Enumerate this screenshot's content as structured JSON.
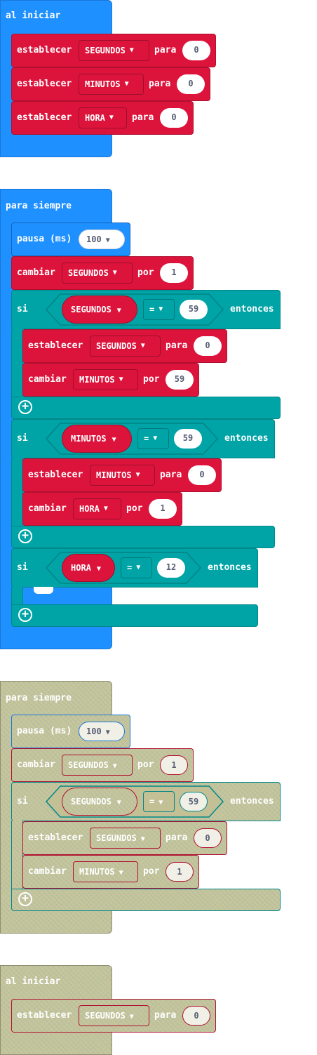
{
  "colors": {
    "events": "#1e90ff",
    "variables": "#dc143c",
    "logic": "#00a4a6",
    "disabled": "#c8c59c"
  },
  "group1": {
    "hat": "al iniciar",
    "rows": [
      {
        "verb": "establecer",
        "var": "SEGUNDOS",
        "prep": "para",
        "value": "0"
      },
      {
        "verb": "establecer",
        "var": "MINUTOS",
        "prep": "para",
        "value": "0"
      },
      {
        "verb": "establecer",
        "var": "HORA",
        "prep": "para",
        "value": "0"
      }
    ]
  },
  "group2": {
    "hat": "para siempre",
    "pause": {
      "label": "pausa (ms)",
      "value": "100"
    },
    "change": {
      "verb": "cambiar",
      "var": "SEGUNDOS",
      "prep": "por",
      "value": "1"
    },
    "if1": {
      "si": "si",
      "var": "SEGUNDOS",
      "op": "=",
      "value": "59",
      "then": "entonces",
      "set": {
        "verb": "establecer",
        "var": "SEGUNDOS",
        "prep": "para",
        "value": "0"
      },
      "change": {
        "verb": "cambiar",
        "var": "MINUTOS",
        "prep": "por",
        "value": "59"
      }
    },
    "if2": {
      "si": "si",
      "var": "MINUTOS",
      "op": "=",
      "value": "59",
      "then": "entonces",
      "set": {
        "verb": "establecer",
        "var": "MINUTOS",
        "prep": "para",
        "value": "0"
      },
      "change": {
        "verb": "cambiar",
        "var": "HORA",
        "prep": "por",
        "value": "1"
      }
    },
    "if3": {
      "si": "si",
      "var": "HORA",
      "op": "=",
      "value": "12",
      "then": "entonces"
    }
  },
  "group3": {
    "hat": "para siempre",
    "pause": {
      "label": "pausa (ms)",
      "value": "100"
    },
    "change": {
      "verb": "cambiar",
      "var": "SEGUNDOS",
      "prep": "por",
      "value": "1"
    },
    "if1": {
      "si": "si",
      "var": "SEGUNDOS",
      "op": "=",
      "value": "59",
      "then": "entonces",
      "set": {
        "verb": "establecer",
        "var": "SEGUNDOS",
        "prep": "para",
        "value": "0"
      },
      "change": {
        "verb": "cambiar",
        "var": "MINUTOS",
        "prep": "por",
        "value": "1"
      }
    }
  },
  "group4": {
    "hat": "al iniciar",
    "set": {
      "verb": "establecer",
      "var": "SEGUNDOS",
      "prep": "para",
      "value": "0"
    }
  },
  "icons": {
    "dropdown": "caret-down",
    "add": "plus-circle"
  }
}
